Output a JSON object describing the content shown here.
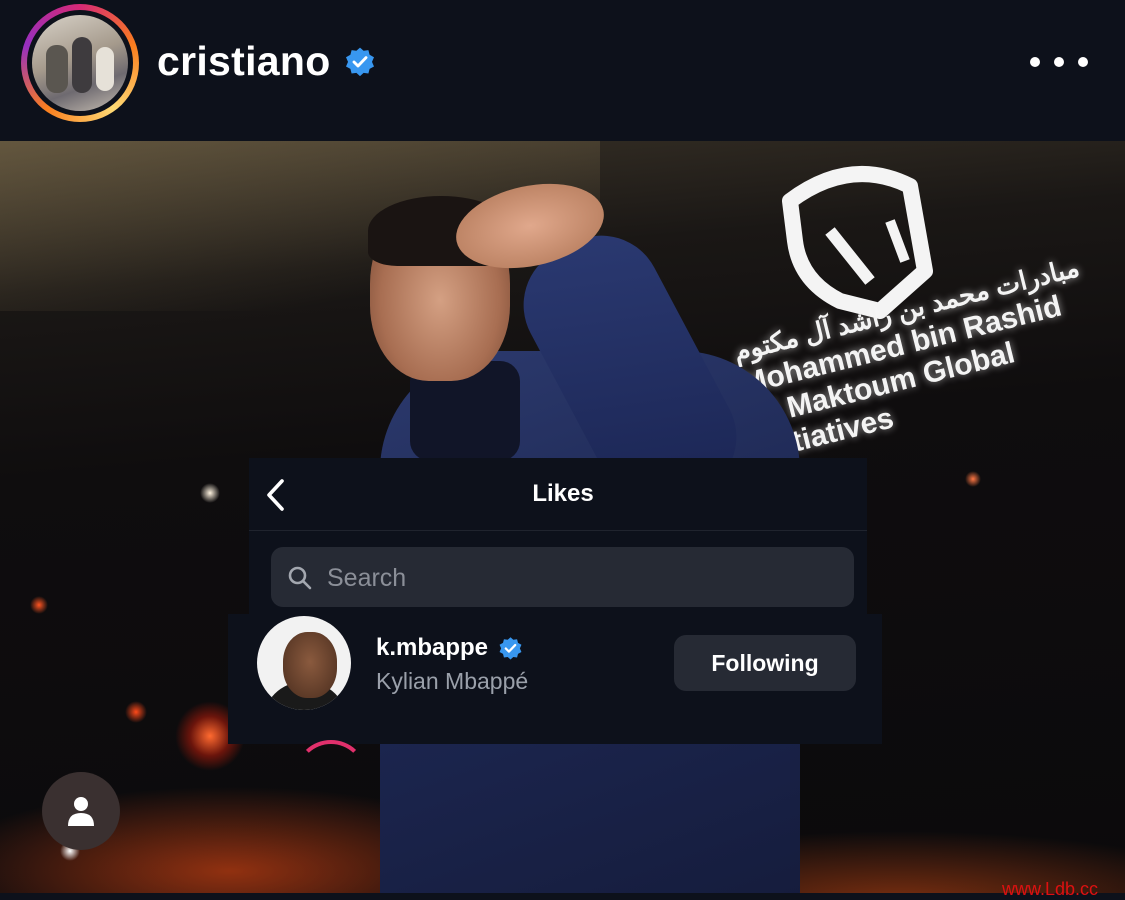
{
  "header": {
    "username": "cristiano",
    "verified": true,
    "avatar_icon": "profile-photo",
    "more_icon": "more-horizontal-icon"
  },
  "post": {
    "logo_text_arabic": "مبادرات محمد بن راشد آل مكتوم",
    "logo_text_line1": "Mohammed bin Rashid",
    "logo_text_line2": "Al Maktoum Global Initiatives"
  },
  "likes": {
    "title": "Likes",
    "back_icon": "chevron-left-icon",
    "search_placeholder": "Search",
    "users": [
      {
        "handle": "k.mbappe",
        "full_name": "Kylian Mbappé",
        "verified": true,
        "button_label": "Following"
      }
    ]
  },
  "bottom": {
    "profile_icon": "person-icon"
  },
  "watermark": "www.Ldb.cc",
  "colors": {
    "background": "#0d111b",
    "verified_blue": "#3897f0",
    "button_bg": "#262a34",
    "secondary_text": "#9aa0aa"
  }
}
